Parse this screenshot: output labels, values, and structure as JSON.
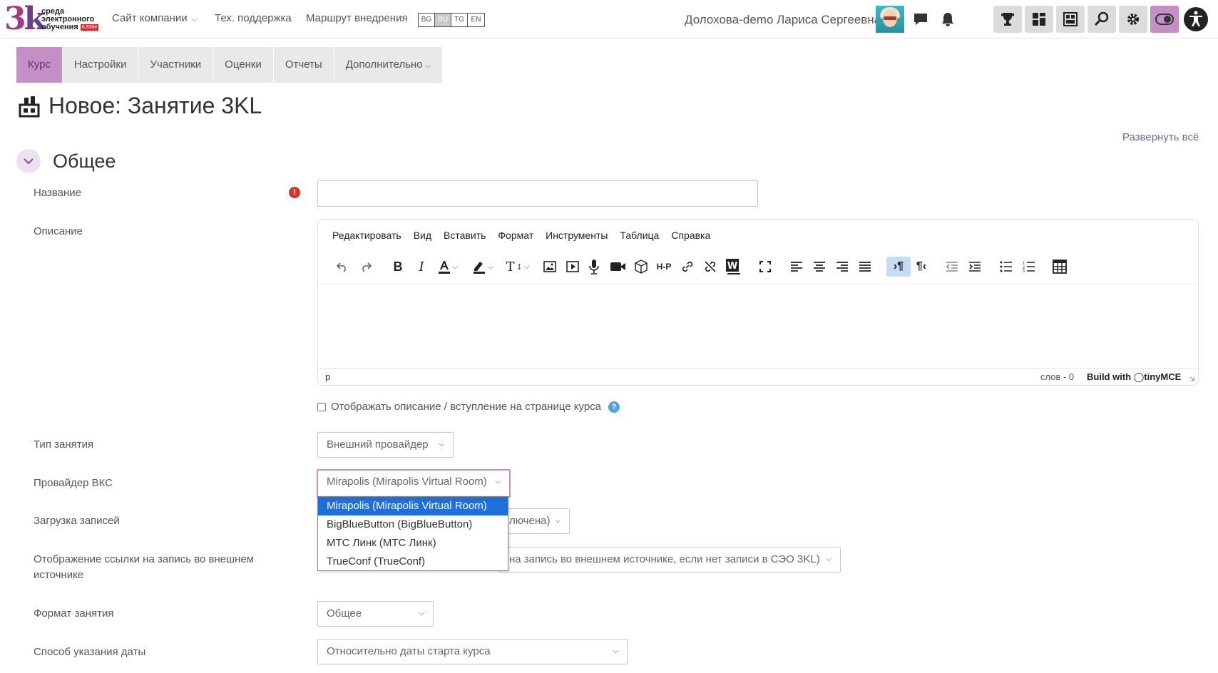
{
  "brand": {
    "mark": "3k",
    "line1": "среда",
    "line2": "электронного",
    "line3": "обучения",
    "version": "6.530e"
  },
  "topnav": {
    "company": "Сайт компании",
    "support": "Тех. поддержка",
    "route": "Маршрут внедрения"
  },
  "languages": [
    "BG",
    "RU",
    "TG",
    "EN"
  ],
  "user": {
    "name": "Долохова-demo Лариса Сергеевна"
  },
  "secnav": [
    "Курс",
    "Настройки",
    "Участники",
    "Оценки",
    "Отчеты",
    "Дополнительно"
  ],
  "page_title": "Новое: Занятие 3KL",
  "expand_all": "Развернуть всё",
  "section_title": "Общее",
  "fields": {
    "name_label": "Название",
    "description_label": "Описание",
    "type_label": "Тип занятия",
    "provider_label": "Провайдер ВКС",
    "recordings_label": "Загрузка записей",
    "link_display_label": "Отображение ссылки на запись во внешнем источнике",
    "format_label": "Формат занятия",
    "date_method_label": "Способ указания даты"
  },
  "editor": {
    "menu": [
      "Редактировать",
      "Вид",
      "Вставить",
      "Формат",
      "Инструменты",
      "Таблица",
      "Справка"
    ],
    "path": "p",
    "word_count": "слов - 0",
    "built_with": "Build with",
    "brand": "tinyMCE"
  },
  "show_description": "Отображать описание / вступление на странице курса",
  "selects": {
    "type": "Внешний провайдер",
    "provider": "Mirapolis (Mirapolis Virtual Room)",
    "recordings_tail": "лючена)",
    "link_display_tail": "на запись во внешнем источнике, если нет записи в СЭО 3KL)",
    "format": "Общее",
    "date_method": "Относительно даты старта курса"
  },
  "provider_options": [
    "Mirapolis (Mirapolis Virtual Room)",
    "BigBlueButton (BigBlueButton)",
    "МТС Линк (МТС Линк)",
    "TrueConf (TrueConf)"
  ],
  "colors": {
    "accent": "#c38fc6",
    "selection": "#1e6fd9",
    "required": "#d9342b"
  }
}
